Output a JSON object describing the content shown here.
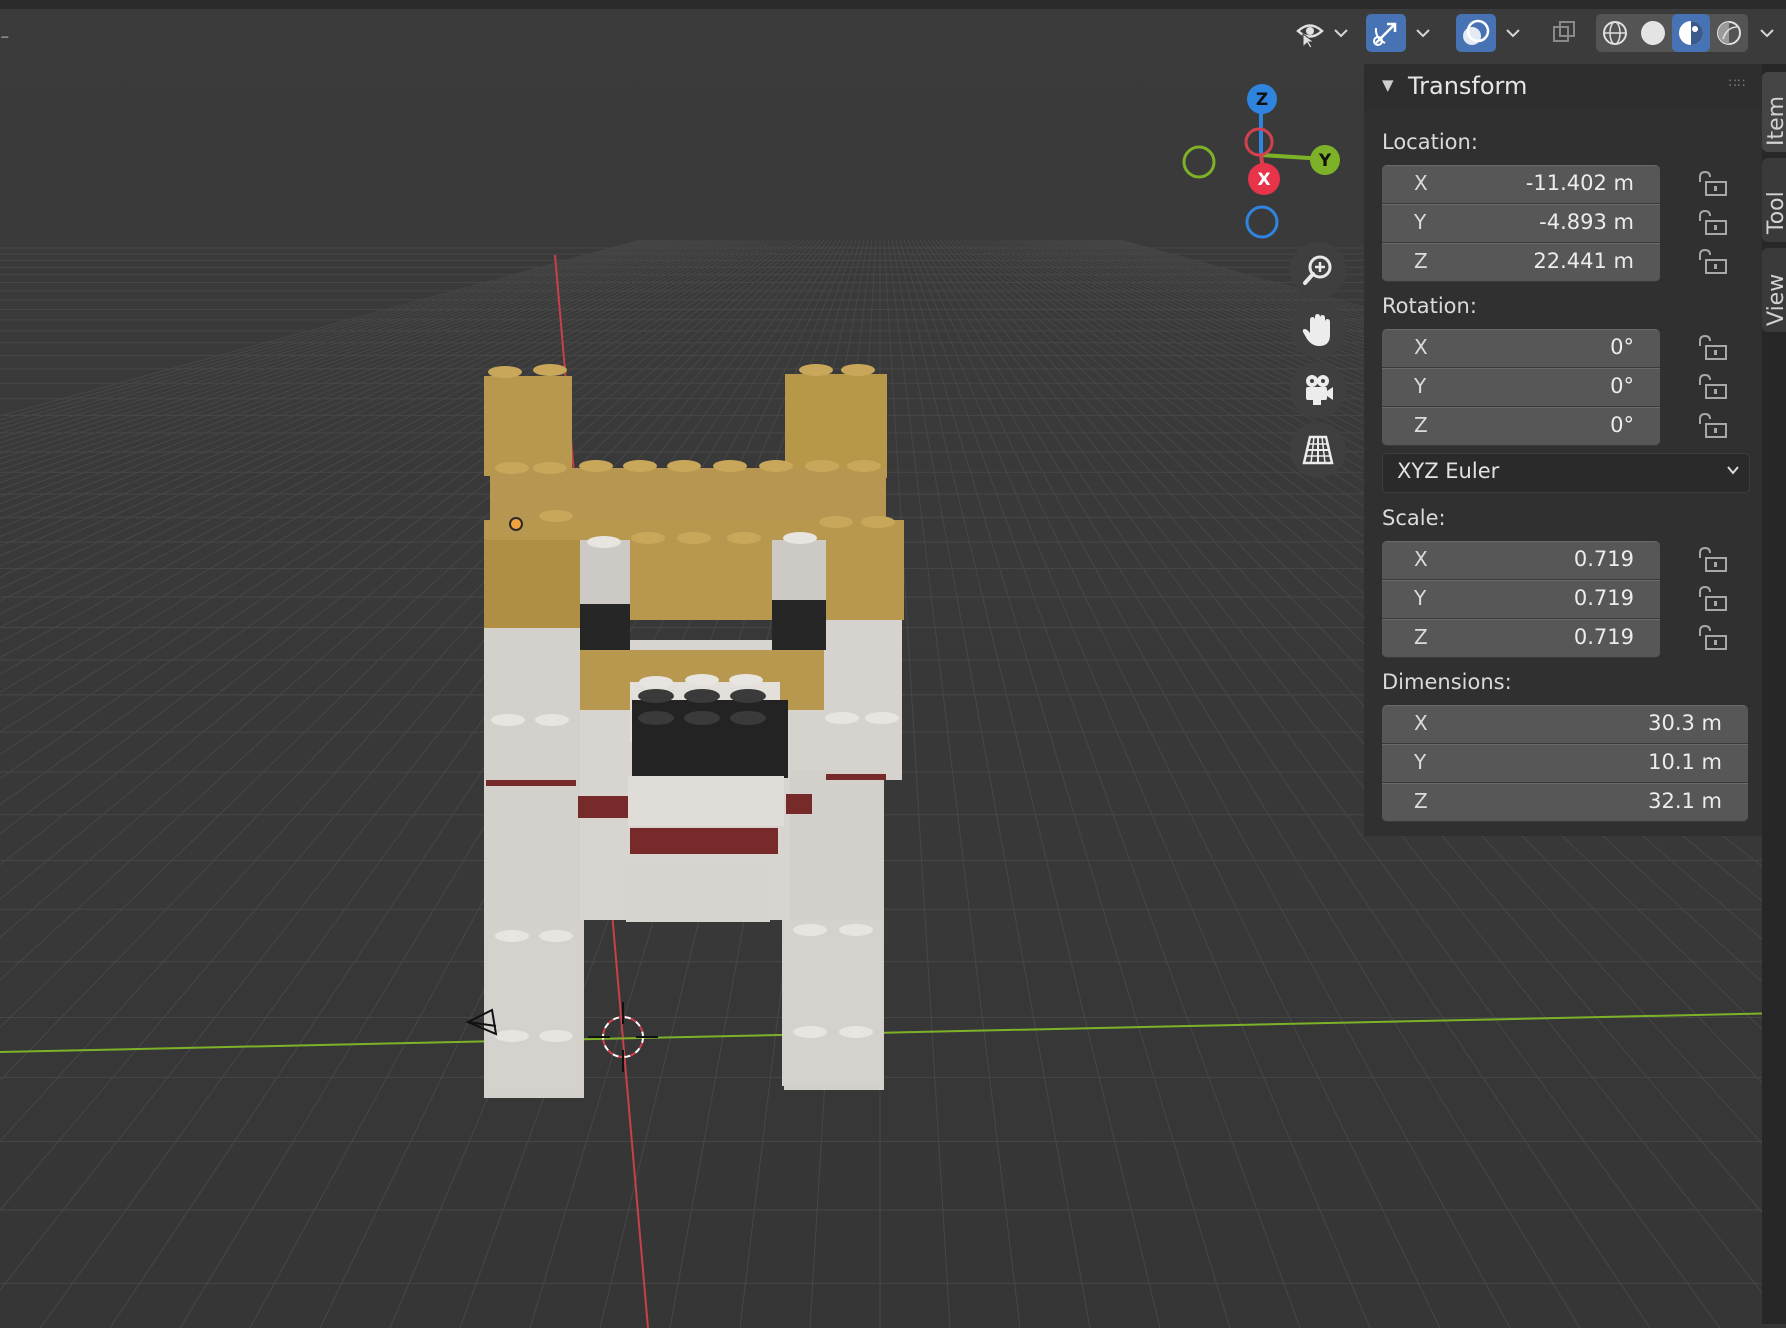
{
  "viewport": {
    "header_icons": [
      "selectability-visibility-icon",
      "gizmo-icon",
      "overlays-icon",
      "xray-icon",
      "wireframe-shading-icon",
      "solid-shading-icon",
      "material-preview-icon",
      "rendered-shading-icon"
    ],
    "nav_gizmo": {
      "x_label": "X",
      "y_label": "Y",
      "z_label": "Z"
    },
    "nav_buttons": [
      "zoom-icon",
      "pan-hand-icon",
      "camera-icon",
      "grid-perspective-icon"
    ],
    "colors": {
      "background": "#3b3b3b",
      "grid": "#4a4a4a",
      "x_axis": "#d3414f",
      "y_axis": "#7db228",
      "z_axis": "#2f84e0",
      "accent": "#4772b3"
    }
  },
  "panel": {
    "title": "Transform",
    "location": {
      "label": "Location:",
      "rows": [
        {
          "axis": "X",
          "value": "-11.402 m"
        },
        {
          "axis": "Y",
          "value": "-4.893 m"
        },
        {
          "axis": "Z",
          "value": "22.441 m"
        }
      ]
    },
    "rotation": {
      "label": "Rotation:",
      "rows": [
        {
          "axis": "X",
          "value": "0°"
        },
        {
          "axis": "Y",
          "value": "0°"
        },
        {
          "axis": "Z",
          "value": "0°"
        }
      ],
      "mode": "XYZ Euler"
    },
    "scale": {
      "label": "Scale:",
      "rows": [
        {
          "axis": "X",
          "value": "0.719"
        },
        {
          "axis": "Y",
          "value": "0.719"
        },
        {
          "axis": "Z",
          "value": "0.719"
        }
      ]
    },
    "dimensions": {
      "label": "Dimensions:",
      "rows": [
        {
          "axis": "X",
          "value": "30.3 m"
        },
        {
          "axis": "Y",
          "value": "10.1 m"
        },
        {
          "axis": "Z",
          "value": "32.1 m"
        }
      ]
    }
  },
  "sidebar_tabs": [
    {
      "label": "Item",
      "active": true
    },
    {
      "label": "Tool",
      "active": false
    },
    {
      "label": "View",
      "active": false
    }
  ]
}
